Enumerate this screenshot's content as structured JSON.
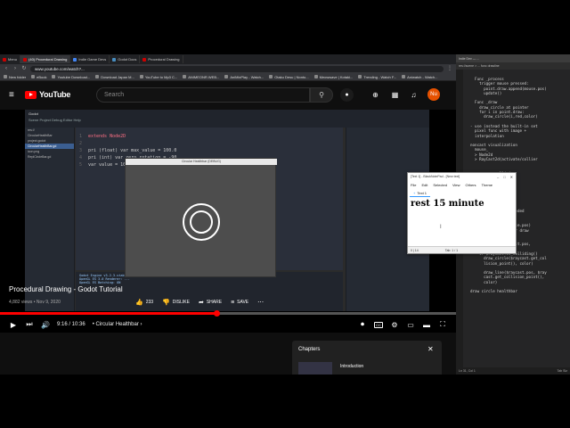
{
  "browser": {
    "tabs": [
      {
        "label": "Menu",
        "active": false
      },
      {
        "label": "(40) Procedural Drawing",
        "active": true
      },
      {
        "label": "Indie Game Devs",
        "active": false
      },
      {
        "label": "Godot Docs",
        "active": false
      },
      {
        "label": "Procedural Drawing",
        "active": false
      }
    ],
    "url": "www.youtube.com/watch?...",
    "bookmarks": [
      "New folder",
      "eBook",
      "Youtube Download...",
      "Download Japan M...",
      "YouTube to Mp3 C...",
      "ANIMEONR.WEB...",
      "AniMixPlay - Watch...",
      "Otaku Desu | Nonto...",
      "Meowwave | Kotaki...",
      "Trending - Watch F...",
      "Aniwatch - Watch..."
    ]
  },
  "youtube": {
    "logo_text": "YouTube",
    "search_placeholder": "Search",
    "avatar_initials": "Nu"
  },
  "godot": {
    "title": "Godot",
    "menu": "Scene  Project  Debug  Editor  Help",
    "file_tree": [
      "res://",
      "CircularHealthBar",
      "project.godot",
      "CircularHealthBar.gd",
      "icon.png",
      "ReplCircleBar.gd"
    ],
    "selected_file": "CircularHealthBar.gd",
    "code": [
      {
        "n": "1",
        "text": "extends Node2D"
      },
      {
        "n": "2",
        "text": ""
      },
      {
        "n": "3",
        "text": "pri (float) var max_value = 100.0"
      },
      {
        "n": "4",
        "text": "pri (int) var zero_rotation = -90"
      },
      {
        "n": "5",
        "text": "var value = 100.0"
      }
    ],
    "output_lines": [
      "Godot Engine v3.2.3.stable.official - https://godotengine.org",
      "OpenGL ES 3.0 Renderer: ...",
      "OpenGL ES Batching: ON"
    ],
    "game_window_title": "Circular Healthbar (DEBUG)"
  },
  "player": {
    "progress_fraction": 0.475,
    "time": "9:16 / 10:36",
    "chapter": "Circular Healthbar",
    "icons": [
      "play-icon",
      "next-icon",
      "volume-icon"
    ]
  },
  "video": {
    "title": "Procedural Drawing - Godot Tutorial",
    "meta": "4,882 views • Nov 9, 2020",
    "likes": "233",
    "dislike_label": "DISLIKE",
    "share_label": "SHARE",
    "save_label": "SAVE"
  },
  "chapters": {
    "title": "Chapters",
    "first_item": "Introduction"
  },
  "code_panel": {
    "tabs": "Indie Dev — ...",
    "sub": "res://scene > ...  func drawline",
    "lines": [
      "  Func _process",
      "    trigger mouse pressed:",
      "      point.draw.append(mouse.pos)",
      "      update()",
      "",
      "  Func _draw",
      "    draw_circle at pointer",
      "    for i in point.draw:",
      "      draw_circle(i,red,color)",
      "",
      "- use instead the built-in set",
      "  pixel func with image +",
      "  interpolation",
      "",
      "noncast visualization",
      "  mouse_",
      "  > Node2d",
      "  > RayCast2d(activate/collier",
      "",
      "",
      "        go collision",
      "        wall",
      "",
      "        ",
      "        ",
      "        cast2d",
      "",
      "        ",
      "        l as much needed",
      "        ",
      "        ",
      "        local_at(mouse.pos)",
      "        update() #for draw",
      "",
      "  Func _draw",
      "    draw_line($raycast.pos,",
      "      color)",
      "    if $raycast.is_colliding()",
      "      draw_circle($raycast.get_col",
      "      lision_point(), color)",
      "",
      "      draw_line($raycast.pos, $ray",
      "      cast.get_collision_point(),",
      "      color)",
      "",
      "draw circle healthbar"
    ],
    "status_left": "Ln 31, Col 1",
    "status_right": "Tab Siz"
  },
  "notepad": {
    "title": "[Text 1] - BlackNotePad - [New text]",
    "menu": [
      "File",
      "Edit",
      "Selected",
      "View",
      "Others",
      "Theme"
    ],
    "tab_label": "Text 1",
    "content": "rest 15 minute",
    "status_left": "0 | 14",
    "status_right": "Tab: 1 / 1"
  },
  "colors": {
    "youtube_red": "#ff0000",
    "background": "#0f0f0f"
  }
}
